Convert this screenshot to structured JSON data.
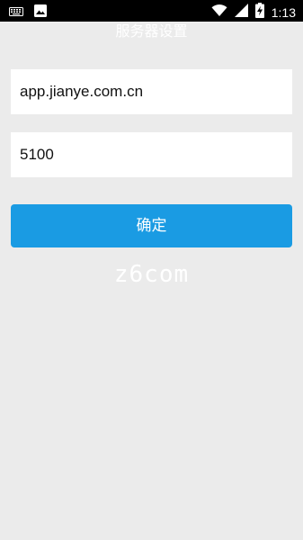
{
  "status_bar": {
    "left_icons": [
      "keyboard-icon",
      "image-icon"
    ],
    "right_icons": [
      "wifi-icon",
      "signal-icon",
      "battery-charging-icon"
    ],
    "time": "1:13"
  },
  "page": {
    "title": "服务器设置"
  },
  "form": {
    "server_value": "app.jianye.com.cn",
    "port_value": "5100",
    "confirm_label": "确定"
  },
  "watermark": {
    "text": "z6com"
  },
  "colors": {
    "background": "#ebebeb",
    "accent": "#1a9be3",
    "status_bar": "#000000"
  }
}
